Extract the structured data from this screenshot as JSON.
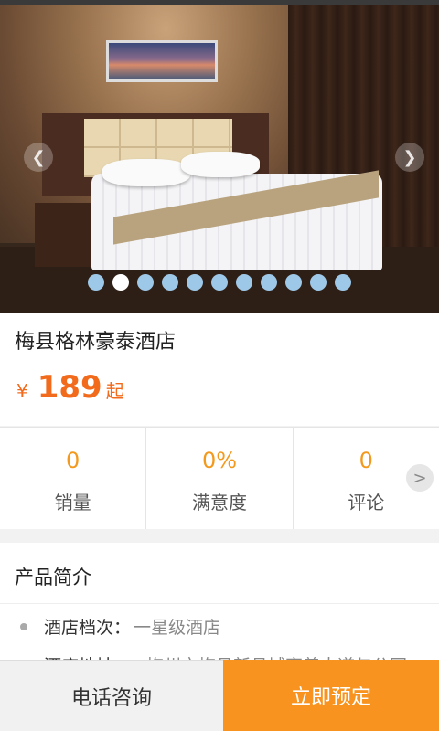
{
  "hotel": {
    "name": "梅县格林豪泰酒店",
    "price_symbol": "¥",
    "price": "189",
    "price_suffix": "起"
  },
  "carousel": {
    "total_images": 11,
    "active_index": 1,
    "prev_icon": "chevron-left-icon",
    "next_icon": "chevron-right-icon"
  },
  "stats": [
    {
      "value": "0",
      "label": "销量"
    },
    {
      "value": "0%",
      "label": "满意度"
    },
    {
      "value": "0",
      "label": "评论"
    }
  ],
  "stats_more_icon": "chevron-right-icon",
  "intro": {
    "title": "产品简介",
    "rows": [
      {
        "label": "酒店档次：",
        "value": "一星级酒店"
      },
      {
        "label": "酒店地址：",
        "value": "梅州市梅县新县城宪善大道与公园"
      }
    ]
  },
  "bottom_bar": {
    "call_label": "电话咨询",
    "book_label": "立即预定"
  },
  "colors": {
    "accent_orange": "#f26b1d",
    "stat_orange": "#f39a1e",
    "book_button": "#f7931e",
    "dot_inactive": "#9ec8e8",
    "dot_active": "#ffffff"
  }
}
